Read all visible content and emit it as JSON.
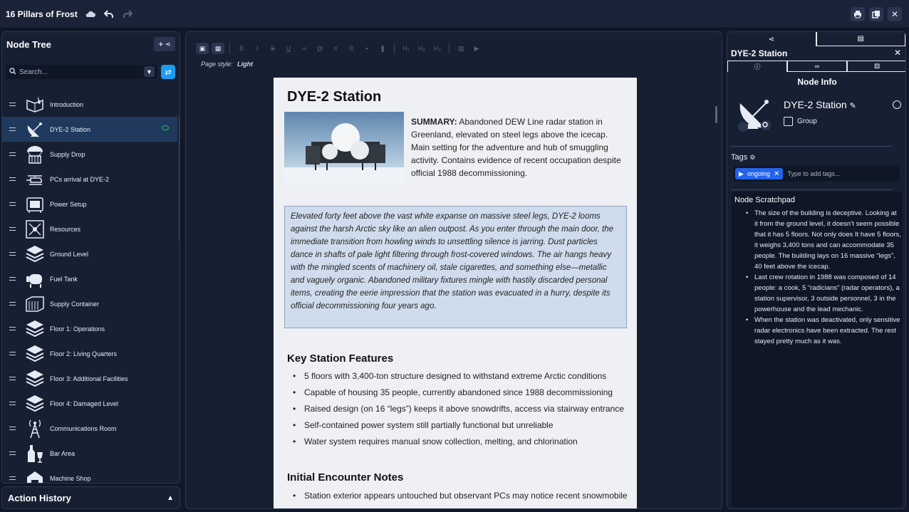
{
  "app": {
    "title": "16 Pillars of Frost"
  },
  "node_tree": {
    "heading": "Node Tree",
    "search_placeholder": "Search...",
    "items": [
      {
        "label": "Introduction",
        "icon": "book-quill-icon"
      },
      {
        "label": "DYE-2 Station",
        "icon": "radar-dish-icon",
        "selected": true
      },
      {
        "label": "Supply Drop",
        "icon": "parachute-crate-icon"
      },
      {
        "label": "PCs arrival at DYE-2",
        "icon": "helicopter-icon"
      },
      {
        "label": "Power Setup",
        "icon": "generator-icon"
      },
      {
        "label": "Resources",
        "icon": "network-icon"
      },
      {
        "label": "Ground Level",
        "icon": "stack-layers-icon"
      },
      {
        "label": "Fuel Tank",
        "icon": "fuel-tank-icon"
      },
      {
        "label": "Supply Container",
        "icon": "container-icon"
      },
      {
        "label": "Floor 1: Operations",
        "icon": "stack-layers-icon"
      },
      {
        "label": "Floor 2: Living Quarters",
        "icon": "stack-layers-icon"
      },
      {
        "label": "Floor 3: Additional Facilities",
        "icon": "stack-layers-icon"
      },
      {
        "label": "Floor 4: Damaged Level",
        "icon": "stack-layers-icon"
      },
      {
        "label": "Communications Room",
        "icon": "antenna-tower-icon"
      },
      {
        "label": "Bar Area",
        "icon": "bottle-glass-icon"
      },
      {
        "label": "Machine Shop",
        "icon": "workshop-icon"
      }
    ]
  },
  "action_history": {
    "heading": "Action History"
  },
  "editor": {
    "page_style_label": "Page style:",
    "page_style_value": "Light",
    "doc": {
      "title": "DYE-2 Station",
      "summary_label": "SUMMARY:",
      "summary_text": " Abandoned DEW Line radar station in Greenland, elevated on steel legs above the icecap. Main setting for the adventure and hub of smuggling activity. Contains evidence of recent occupation despite official 1988 decommissioning.",
      "quote": "Elevated forty feet above the vast white expanse on massive steel legs, DYE-2 looms against the harsh Arctic sky like an alien outpost. As you enter through the main door, the immediate transition from howling winds to unsettling silence is jarring. Dust particles dance in shafts of pale light filtering through frost-covered windows. The air hangs heavy with the mingled scents of machinery oil, stale cigarettes, and something else—metallic and vaguely organic. Abandoned military fixtures mingle with hastily discarded personal items, creating the eerie impression that the station was evacuated in a hurry, despite its official decommissioning four years ago.",
      "features_heading": "Key Station Features",
      "features": [
        "5 floors with 3,400-ton structure designed to withstand extreme Arctic conditions",
        "Capable of housing 35 people, currently abandoned since 1988 decommissioning",
        "Raised design (on 16 “legs”) keeps it above snowdrifts, access via stairway entrance",
        "Self-contained power system still partially functional but unreliable",
        "Water system requires manual snow collection, melting, and chlorination"
      ],
      "encounter_heading": "Initial Encounter Notes",
      "encounter": [
        "Station exterior appears untouched but observant PCs may notice recent snowmobile"
      ]
    }
  },
  "inspector": {
    "title": "DYE-2 Station",
    "section": "Node Info",
    "node_name": "DYE-2 Station",
    "node_type": "Group",
    "tags_label": "Tags",
    "tags": [
      "ongoing"
    ],
    "tag_placeholder": "Type to add tags...",
    "scratchpad_heading": "Node Scratchpad",
    "scratchpad": [
      "The size of the building is deceptive. Looking at it from the ground level, it doesn’t seem possible that it has 5 floors. Not only does It have 5 floors, it weighs 3,400 tons and can accommodate 35 people. The building lays on 16 massive “legs”, 40 feet above the icecap.",
      "Last crew rotation in 1988 was composed of 14 people: a cook, 5 “radicians” (radar operators), a station supervisor, 3 outside personnel, 3 in the powerhouse and the lead mechanic.",
      "When the station was deactivated, only sensitive radar electronics have been extracted. The rest stayed pretty much as it was."
    ]
  },
  "colors": {
    "accent": "#1d9cf0",
    "tag": "#2563eb",
    "selected_row": "#1f3a5c",
    "visible": "#22c55e"
  }
}
